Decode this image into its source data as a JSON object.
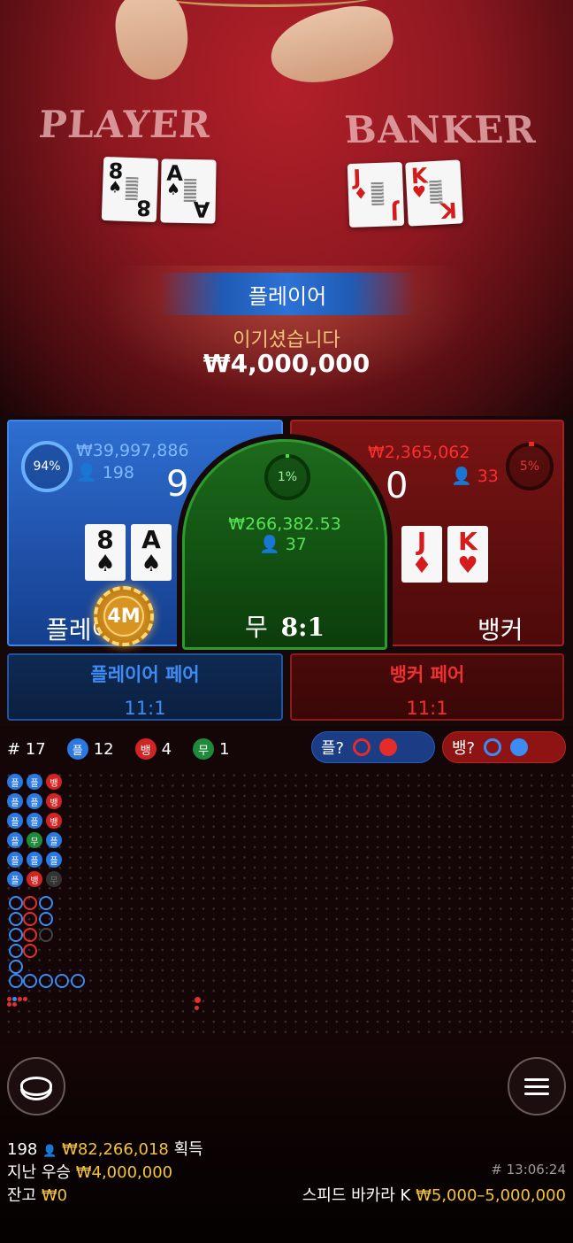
{
  "table": {
    "player_label": "PLAYER",
    "banker_label": "BANKER",
    "player_cards": [
      {
        "rank": "8",
        "suit": "♠",
        "color": "black"
      },
      {
        "rank": "A",
        "suit": "♠",
        "color": "black"
      }
    ],
    "banker_cards": [
      {
        "rank": "J",
        "suit": "♦",
        "color": "red"
      },
      {
        "rank": "K",
        "suit": "♥",
        "color": "red"
      }
    ]
  },
  "result": {
    "winner": "플레이어",
    "message": "이기셨습니다",
    "amount": "₩4,000,000"
  },
  "bets": {
    "player": {
      "percent": "94%",
      "amount": "₩39,997,886",
      "count_icon": "person-icon",
      "count": "198",
      "score": "9",
      "label": "플레이어",
      "cards": [
        {
          "rank": "8",
          "suit": "♠"
        },
        {
          "rank": "A",
          "suit": "♠"
        }
      ],
      "chip": "4M"
    },
    "tie": {
      "percent": "1%",
      "amount": "₩266,382.53",
      "count": "37",
      "label": "무",
      "odds": "8:1"
    },
    "banker": {
      "percent": "5%",
      "amount": "₩2,365,062",
      "count": "33",
      "score": "0",
      "label": "뱅커",
      "cards": [
        {
          "rank": "J",
          "suit": "♦"
        },
        {
          "rank": "K",
          "suit": "♥"
        }
      ]
    },
    "player_pair": {
      "label": "플레이어 페어",
      "odds": "11:1"
    },
    "banker_pair": {
      "label": "뱅커 페어",
      "odds": "11:1"
    }
  },
  "roadmap": {
    "round": "# 17",
    "player_badge": "플",
    "player_count": "12",
    "banker_badge": "뱅",
    "banker_count": "4",
    "tie_badge": "무",
    "tie_count": "1",
    "ask_player": "플?",
    "ask_banker": "뱅?",
    "bead_columns": [
      [
        "p",
        "p",
        "p",
        "p",
        "p",
        "p"
      ],
      [
        "p",
        "p",
        "p",
        "t",
        "p",
        "b"
      ],
      [
        "b",
        "b",
        "b",
        "p",
        "p",
        "x"
      ]
    ]
  },
  "footer": {
    "players": "198",
    "total_won": "₩82,266,018",
    "total_won_suffix": "획득",
    "last_win_label": "지난 우승",
    "last_win": "₩4,000,000",
    "time": "# 13:06:24",
    "balance_label": "잔고",
    "balance": "₩0",
    "table_name": "스피드 바카라 K",
    "limits": "₩5,000–5,000,000"
  },
  "colors": {
    "player": "#2a78e0",
    "banker": "#d12424",
    "tie": "#1f8a3a",
    "gold": "#f3c435"
  }
}
